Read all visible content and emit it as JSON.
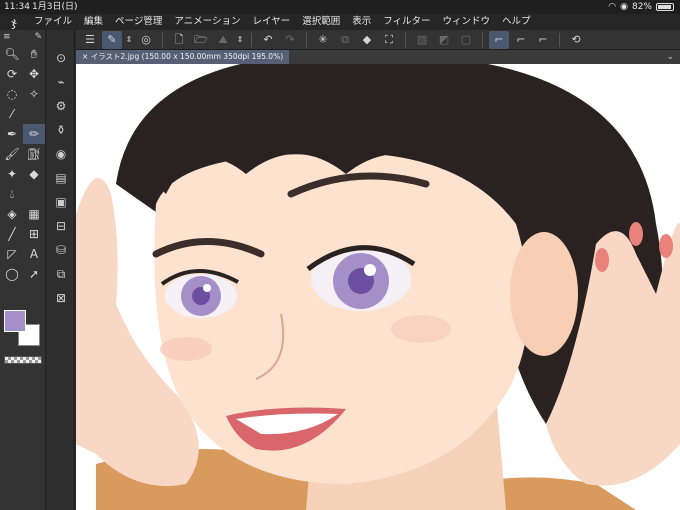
{
  "status": {
    "time": "11:34",
    "date": "1月3日(日)",
    "battery": "82%",
    "battery_level": 0.82
  },
  "menu": {
    "items": [
      "ファイル",
      "編集",
      "ページ管理",
      "アニメーション",
      "レイヤー",
      "選択範囲",
      "表示",
      "フィルター",
      "ウィンドウ",
      "ヘルプ"
    ]
  },
  "tab": {
    "title": "イラスト2.jpg (150.00 x 150.00mm 350dpi 195.0%)",
    "close": "×"
  },
  "colors": {
    "main": "#a58fc8",
    "sub": "#ffffff",
    "accent": "#4a5870"
  },
  "tools": {
    "left": [
      "zoom-icon",
      "hand-icon",
      "rotate-icon",
      "move-icon",
      "lasso-icon",
      "magic-wand-icon",
      "eyedropper-icon",
      "pen-icon",
      "pencil-icon",
      "brush-icon",
      "airbrush-icon",
      "decoration-icon",
      "eraser-icon",
      "blend-icon",
      "fill-icon",
      "gradient-icon",
      "line-icon",
      "frame-icon",
      "ruler-icon",
      "text-icon",
      "balloon-icon",
      "object-icon"
    ]
  },
  "text_glyph": "A"
}
